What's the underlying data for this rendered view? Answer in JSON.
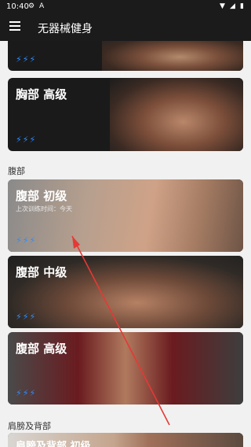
{
  "status": {
    "time": "10:40",
    "left_icons": [
      "settings-icon",
      "a-icon"
    ],
    "right_icons": [
      "wifi-icon",
      "signal-icon",
      "battery-icon"
    ]
  },
  "appbar": {
    "title": "无器械健身",
    "menu_icon": "menu-icon"
  },
  "cards": [
    {
      "title": "",
      "sub": "",
      "bolts": "⚡⚡⚡"
    },
    {
      "title": "胸部 高级",
      "sub": "",
      "bolts": "⚡⚡⚡"
    },
    {
      "title": "腹部 初级",
      "sub": "上次训练时间：今天",
      "bolts": "⚡⚡⚡"
    },
    {
      "title": "腹部 中级",
      "sub": "",
      "bolts": "⚡⚡⚡"
    },
    {
      "title": "腹部 高级",
      "sub": "",
      "bolts": "⚡⚡⚡"
    },
    {
      "title": "肩膀及背部 初级",
      "sub": "",
      "bolts": ""
    }
  ],
  "sections": {
    "abs": "腹部",
    "shoulders_back": "肩膀及背部"
  },
  "colors": {
    "bolt_blue": "#2d8cff",
    "annotation_red": "#e53935"
  }
}
